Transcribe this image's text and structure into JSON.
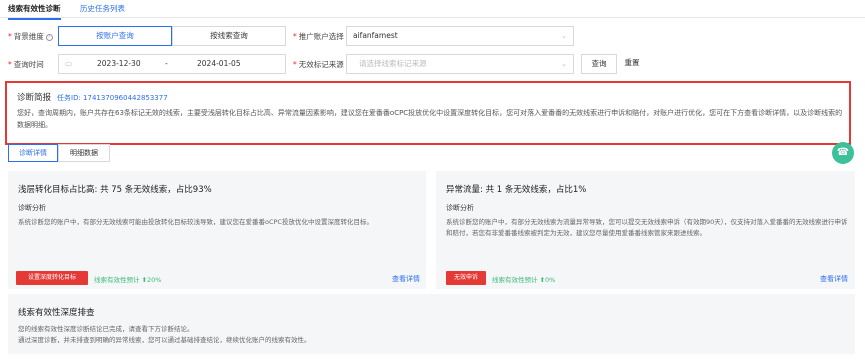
{
  "tabs": [
    "线索有效性诊断",
    "历史任务列表"
  ],
  "filters": {
    "dimension_label": "背景维度",
    "dimension_options": [
      "按账户查询",
      "按线索查询"
    ],
    "account_label": "推广账户选择",
    "account_value": "aifanfamest",
    "time_label": "查询时间",
    "date_start": "2023-12-30",
    "date_sep": "-",
    "date_end": "2024-01-05",
    "reason_label": "无效标记来源",
    "reason_placeholder": "请选择线索标记来源",
    "query_button": "查询",
    "reset_button": "重置"
  },
  "report": {
    "title": "诊断简报",
    "task_id": "任务ID: 1741370960442853377",
    "body": "您好，查询周期内，账户共存在63条标记无效的线索，主要受浅层转化目标占比高、异常流量因素影响，建议您在爱番番oCPC投放优化中设置深度转化目标，您可对落入爱番番的无效线索进行申诉和赔付，对账户进行优化，您可在下方查看诊断详情，以及诊断线索的数据明细。"
  },
  "detail_tabs": [
    "诊断详情",
    "明细数据"
  ],
  "cards": [
    {
      "title": "浅层转化目标占比高: 共 75 条无效线索，占比93%",
      "subtitle": "诊断分析",
      "desc": "系统诊断您的账户中，有部分无效线索可能由投放转化目标较浅导致，建议您在爱番番oCPC投放优化中设置深度转化目标。",
      "action": "设置深度转化目标",
      "effect": "线索有效性预计 ⬆20%",
      "link": "查看详情"
    },
    {
      "title": "异常流量: 共 1 条无效线索，占比1%",
      "subtitle": "诊断分析",
      "desc": "系统诊断您的账户中，有部分无效线索为流量异常导致，您可以提交无效线索申诉（有效期90天），仅支持对落入爱番番的无效线索进行申诉和赔付，若您有非爱番番线索被判定为无效，建议您尽量使用爱番番线索管家来跟进线索。",
      "action": "无效申诉",
      "effect": "线索有效性预计 ⬆0%",
      "link": "查看详情"
    }
  ],
  "bottom_card": {
    "title": "线索有效性深度排查",
    "line1": "您的线索有效性深度诊断结论已完成，请查看下方诊断结论。",
    "line2": "通过深度诊断，并未排查到明确的异常线索，您可以通过基础排查结论，继续优化账户的线索有效性。"
  },
  "colors": {
    "accent": "#2b6ef0",
    "alert": "#e53935",
    "success": "#3dbb7a"
  }
}
